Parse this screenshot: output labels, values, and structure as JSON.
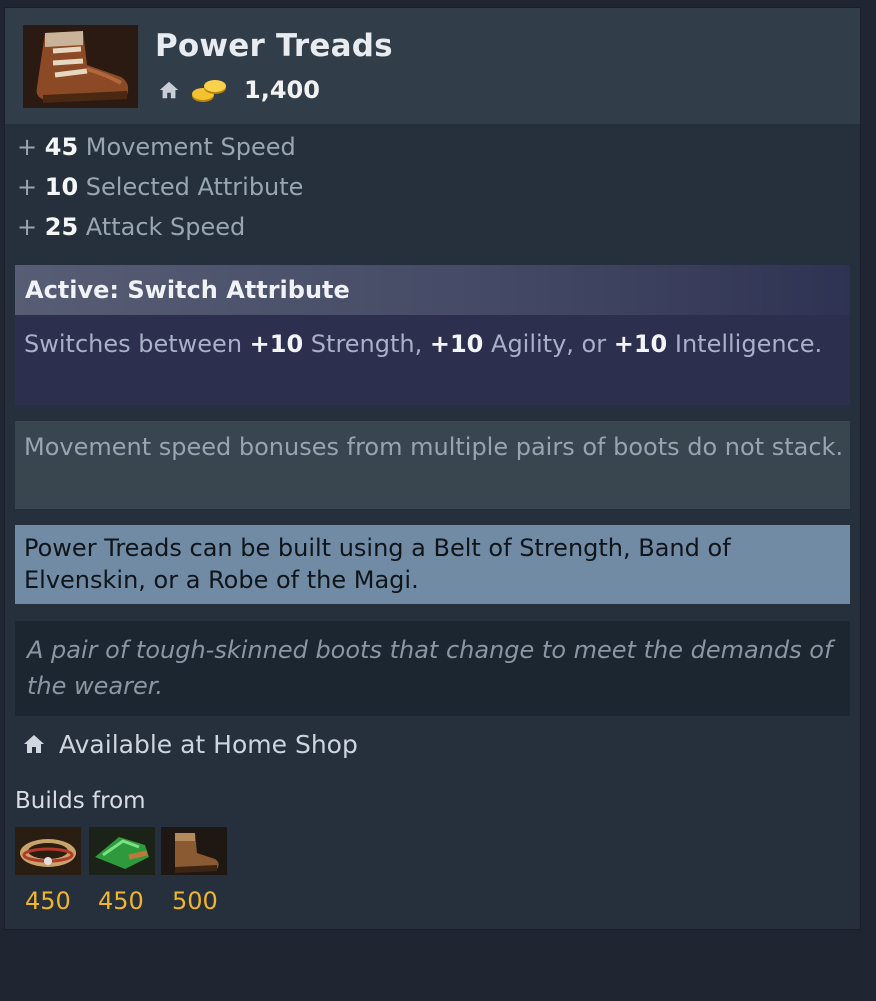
{
  "item": {
    "name": "Power Treads",
    "icon": "power-treads-boot-icon",
    "cost": "1,400",
    "shop_icon": "home-icon",
    "coins_icon": "gold-coins-icon"
  },
  "bonuses": [
    {
      "prefix": "+",
      "value": "45",
      "label": "Movement Speed"
    },
    {
      "prefix": "+",
      "value": "10",
      "label": "Selected Attribute"
    },
    {
      "prefix": "+",
      "value": "25",
      "label": "Attack Speed"
    }
  ],
  "active": {
    "title": "Active: Switch Attribute",
    "desc_parts": [
      "Switches between ",
      "+10",
      " Strength, ",
      "+10",
      " Agility, or ",
      "+10",
      " Intelligence."
    ]
  },
  "note": "Movement speed bonuses from multiple pairs of boots do not stack.",
  "hint": "Power Treads can be built using a Belt of Strength, Band of Elvenskin, or a Robe of the Magi.",
  "lore": "A pair of tough-skinned boots that change to meet the demands of the wearer.",
  "availability": "Available at Home Shop",
  "builds_from": {
    "label": "Builds from",
    "components": [
      {
        "icon": "ring-of-fur-icon",
        "cost": "450"
      },
      {
        "icon": "green-gauntlet-icon",
        "cost": "450"
      },
      {
        "icon": "boots-icon",
        "cost": "500"
      }
    ]
  },
  "colors": {
    "panel": "#26303c",
    "header": "#323d4a",
    "active_bg": "#2c2f4d",
    "note_bg": "#394650",
    "hint_bg": "#708ba3",
    "lore_bg": "#1c2630",
    "gold": "#f2b42a"
  }
}
